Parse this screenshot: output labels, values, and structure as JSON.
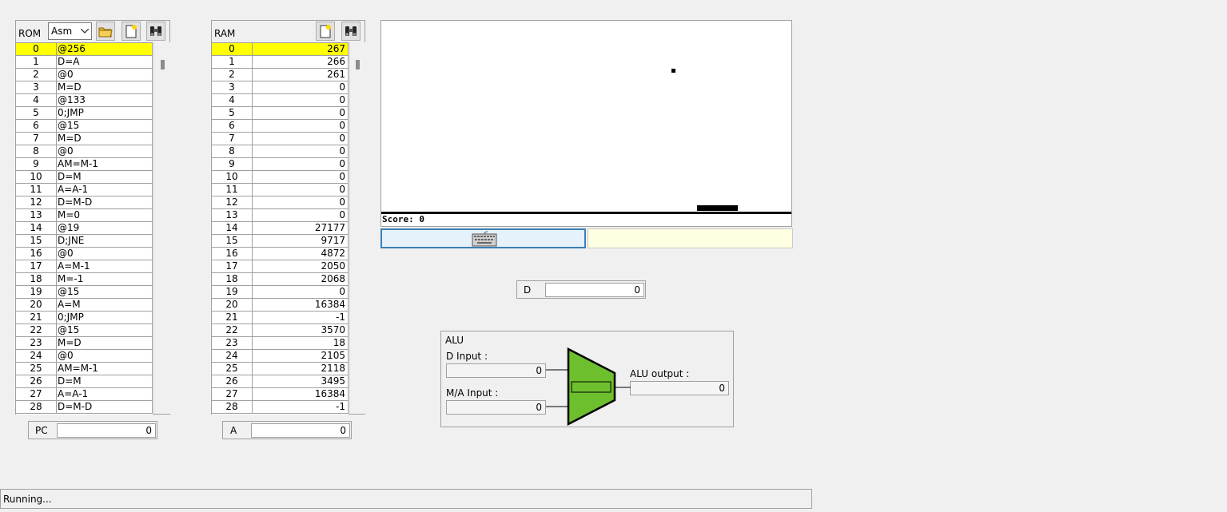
{
  "rom": {
    "title": "ROM",
    "format_selected": "Asm",
    "highlight_index": 0,
    "rows": [
      [
        "0",
        "@256"
      ],
      [
        "1",
        "D=A"
      ],
      [
        "2",
        "@0"
      ],
      [
        "3",
        "M=D"
      ],
      [
        "4",
        "@133"
      ],
      [
        "5",
        "0;JMP"
      ],
      [
        "6",
        "@15"
      ],
      [
        "7",
        "M=D"
      ],
      [
        "8",
        "@0"
      ],
      [
        "9",
        "AM=M-1"
      ],
      [
        "10",
        "D=M"
      ],
      [
        "11",
        "A=A-1"
      ],
      [
        "12",
        "D=M-D"
      ],
      [
        "13",
        "M=0"
      ],
      [
        "14",
        "@19"
      ],
      [
        "15",
        "D;JNE"
      ],
      [
        "16",
        "@0"
      ],
      [
        "17",
        "A=M-1"
      ],
      [
        "18",
        "M=-1"
      ],
      [
        "19",
        "@15"
      ],
      [
        "20",
        "A=M"
      ],
      [
        "21",
        "0;JMP"
      ],
      [
        "22",
        "@15"
      ],
      [
        "23",
        "M=D"
      ],
      [
        "24",
        "@0"
      ],
      [
        "25",
        "AM=M-1"
      ],
      [
        "26",
        "D=M"
      ],
      [
        "27",
        "A=A-1"
      ],
      [
        "28",
        "D=M-D"
      ]
    ],
    "scroll_position": 0.03
  },
  "ram": {
    "title": "RAM",
    "highlight_index": 0,
    "rows": [
      [
        "0",
        "267"
      ],
      [
        "1",
        "266"
      ],
      [
        "2",
        "261"
      ],
      [
        "3",
        "0"
      ],
      [
        "4",
        "0"
      ],
      [
        "5",
        "0"
      ],
      [
        "6",
        "0"
      ],
      [
        "7",
        "0"
      ],
      [
        "8",
        "0"
      ],
      [
        "9",
        "0"
      ],
      [
        "10",
        "0"
      ],
      [
        "11",
        "0"
      ],
      [
        "12",
        "0"
      ],
      [
        "13",
        "0"
      ],
      [
        "14",
        "27177"
      ],
      [
        "15",
        "9717"
      ],
      [
        "16",
        "4872"
      ],
      [
        "17",
        "2050"
      ],
      [
        "18",
        "2068"
      ],
      [
        "19",
        "0"
      ],
      [
        "20",
        "16384"
      ],
      [
        "21",
        "-1"
      ],
      [
        "22",
        "3570"
      ],
      [
        "23",
        "18"
      ],
      [
        "24",
        "2105"
      ],
      [
        "25",
        "2118"
      ],
      [
        "26",
        "3495"
      ],
      [
        "27",
        "16384"
      ],
      [
        "28",
        "-1"
      ]
    ],
    "scroll_position": 0.03
  },
  "pc": {
    "label": "PC",
    "value": "0"
  },
  "a_reg": {
    "label": "A",
    "value": "0"
  },
  "d_reg": {
    "label": "D",
    "value": "0"
  },
  "screen": {
    "score_text": "Score: 0"
  },
  "alu": {
    "title": "ALU",
    "d_input_label": "D Input :",
    "d_input_value": "0",
    "ma_input_label": "M/A Input :",
    "ma_input_value": "0",
    "output_label": "ALU output :",
    "output_value": "0",
    "color": "#6dbf2e"
  },
  "status": {
    "text": "Running..."
  },
  "icons": {
    "rom_load": "folder-icon",
    "rom_clear": "new-file-icon",
    "rom_search": "binoculars-icon",
    "ram_clear": "new-file-icon",
    "ram_search": "binoculars-icon",
    "keyboard": "keyboard-icon"
  }
}
